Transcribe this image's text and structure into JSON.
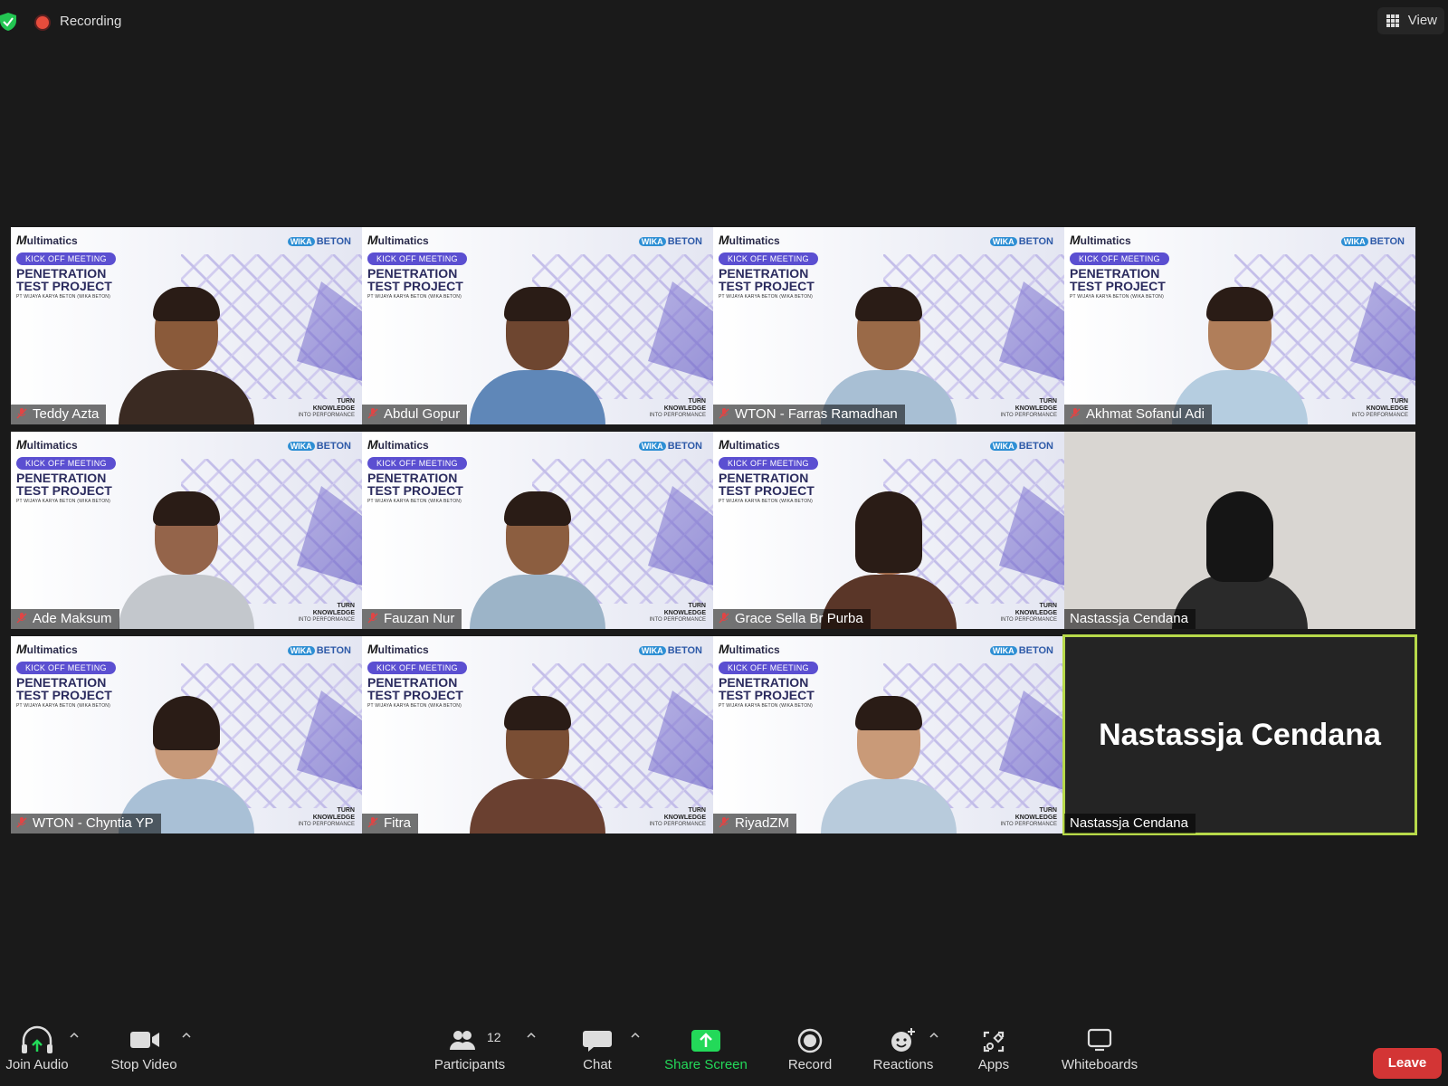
{
  "topbar": {
    "recording_label": "Recording",
    "view_label": "View"
  },
  "slide": {
    "brand_left": "ultimatics",
    "brand_left_initial": "M",
    "brand_right": "BETON",
    "brand_right_badge": "WIKA",
    "kickoff": "KICK OFF MEETING",
    "title_line1": "PENETRATION",
    "title_line2": "TEST PROJECT",
    "subtitle": "PT WIJAYA KARYA BETON (WIKA BETON)",
    "tagline1": "TURN",
    "tagline2": "KNOWLEDGE",
    "tagline3": "INTO PERFORMANCE"
  },
  "participants": [
    {
      "name": "Teddy Azta",
      "muted": true
    },
    {
      "name": "Abdul Gopur",
      "muted": true
    },
    {
      "name": "WTON - Farras Ramadhan",
      "muted": true
    },
    {
      "name": "Akhmat Sofanul Adi",
      "muted": true
    },
    {
      "name": "Ade Maksum",
      "muted": true
    },
    {
      "name": "Fauzan Nur",
      "muted": true
    },
    {
      "name": "Grace Sella Br Purba",
      "muted": true
    },
    {
      "name": "Nastassja Cendana",
      "muted": false
    },
    {
      "name": "WTON - Chyntia YP",
      "muted": true
    },
    {
      "name": "Fitra",
      "muted": true
    },
    {
      "name": "RiyadZM",
      "muted": true
    },
    {
      "name": "Nastassja Cendana",
      "muted": false,
      "camera_off": true,
      "display_name": "Nastassja Cendana",
      "active_speaker": true
    }
  ],
  "toolbar": {
    "join_audio": "Join Audio",
    "stop_video": "Stop Video",
    "participants": "Participants",
    "participants_count": "12",
    "chat": "Chat",
    "share_screen": "Share Screen",
    "record": "Record",
    "reactions": "Reactions",
    "apps": "Apps",
    "whiteboards": "Whiteboards",
    "leave": "Leave"
  },
  "colors": {
    "share_screen_green": "#23d959",
    "leave_red": "#d33535",
    "active_speaker_outline": "#b7d94a",
    "kickoff_pill": "#5b4fd1"
  }
}
